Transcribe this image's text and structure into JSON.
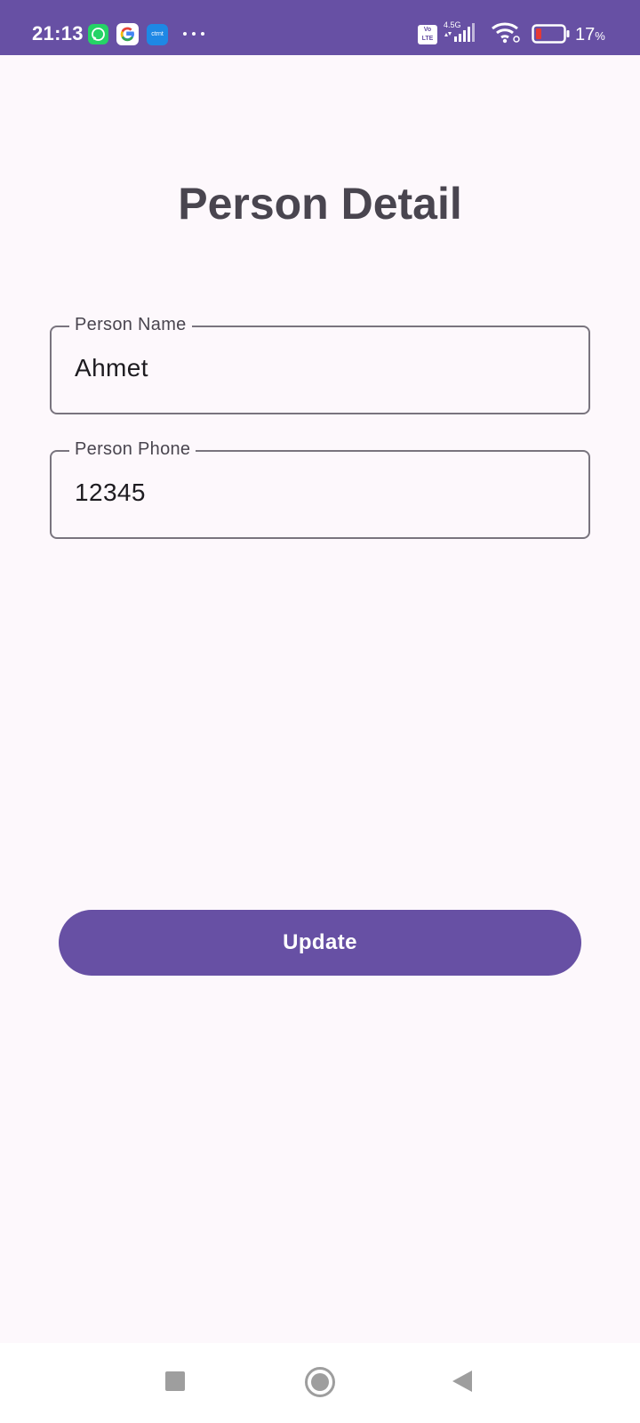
{
  "status_bar": {
    "time": "21:13",
    "app_icon_text": "ctrnt",
    "volte_text": "Vo LTE",
    "network_type": "4.5G",
    "battery_value": "17",
    "battery_unit": "%",
    "background_color": "#6750a4",
    "icons": [
      "whatsapp-icon",
      "google-icon",
      "app-icon",
      "more-icon",
      "volte-icon",
      "signal-icon",
      "wifi-icon",
      "battery-icon"
    ]
  },
  "page": {
    "title": "Person Detail",
    "background_color": "#fdf8fc"
  },
  "form": {
    "name_field": {
      "label": "Person Name",
      "value": "Ahmet"
    },
    "phone_field": {
      "label": "Person Phone",
      "value": "12345"
    },
    "update_button_label": "Update",
    "accent_color": "#6750a4"
  },
  "nav_bar": {
    "buttons": [
      "recents-button",
      "home-button",
      "back-button"
    ]
  }
}
